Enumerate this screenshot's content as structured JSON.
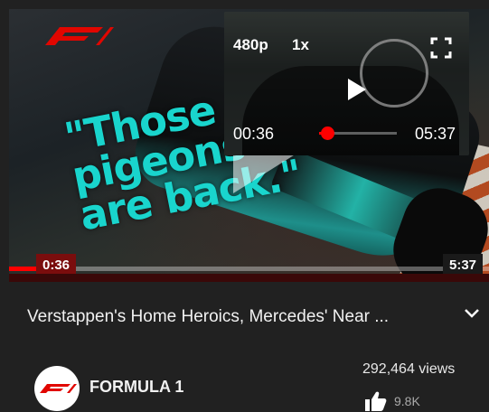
{
  "video": {
    "overlay_quote": "\"Those\npigeons\nare back.\"",
    "time_current": "0:36",
    "time_total": "5:37",
    "progress": 0.107
  },
  "preview": {
    "quality": "480p",
    "speed": "1x",
    "time_current": "00:36",
    "time_total": "05:37",
    "progress": 0.107
  },
  "details": {
    "title": "Verstappen's Home Heroics, Mercedes' Near ...",
    "channel_name": "FORMULA 1",
    "views": "292,464 views",
    "likes": "9.8K"
  },
  "colors": {
    "accent": "#ff0000",
    "quote": "#19d5cd",
    "background": "#212121"
  }
}
